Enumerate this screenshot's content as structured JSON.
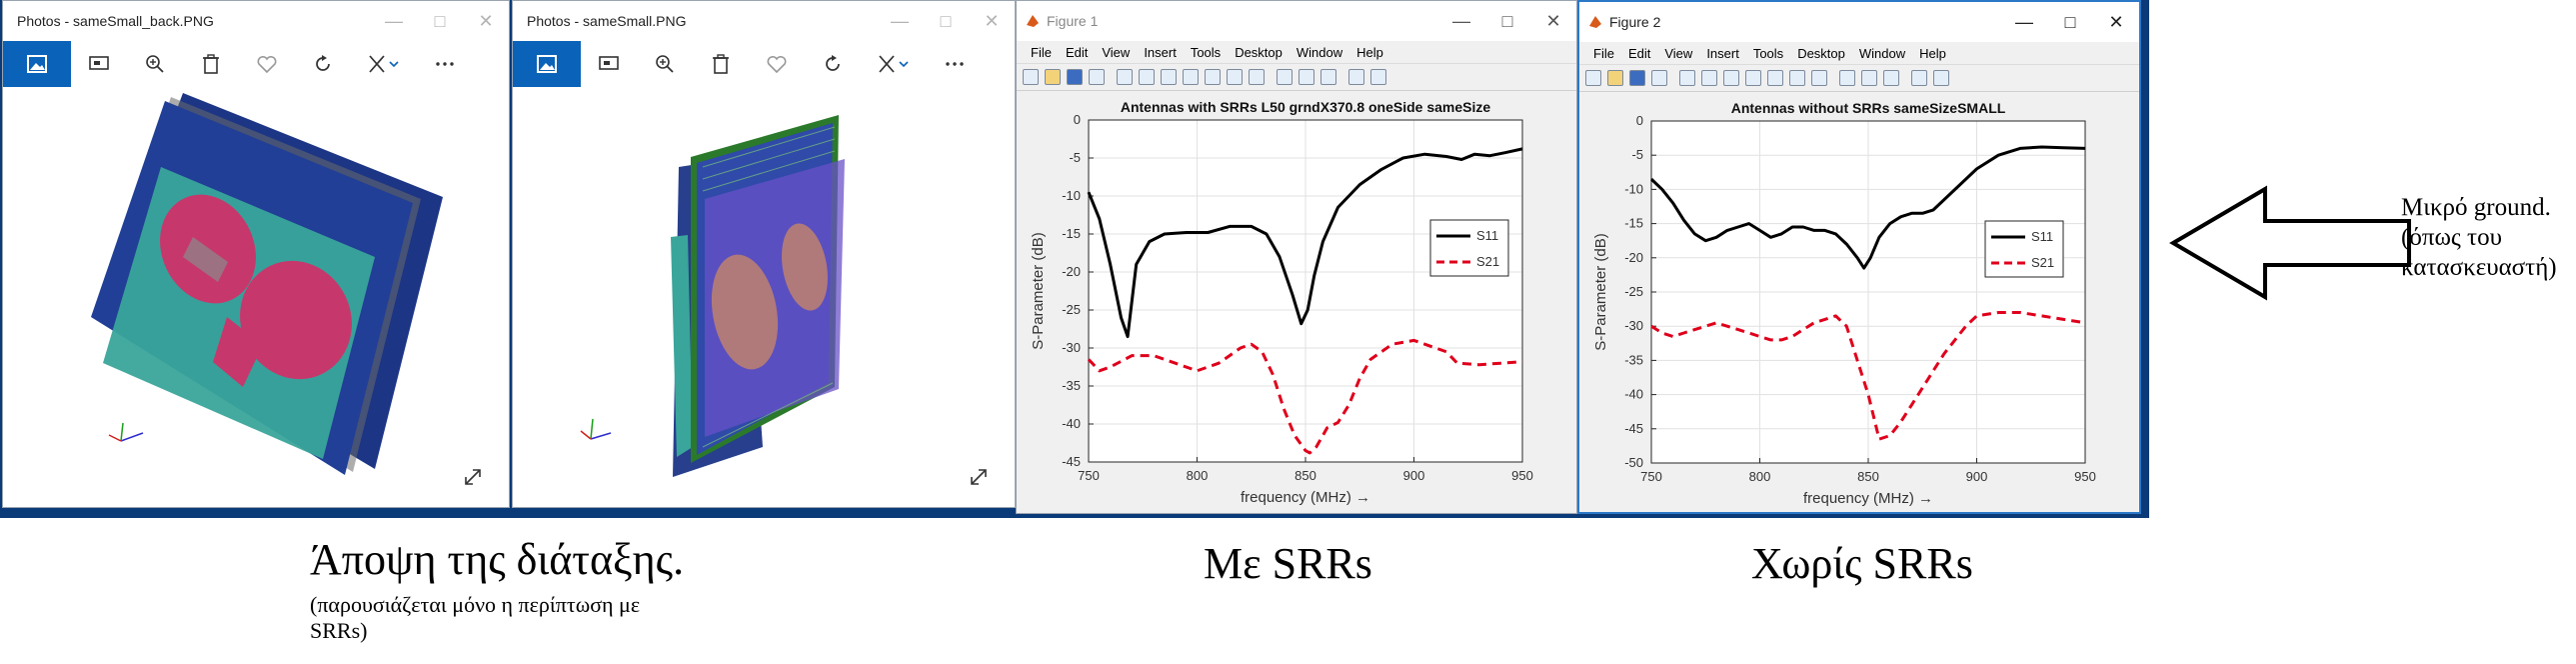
{
  "photos1": {
    "title": "Photos - sameSmall_back.PNG"
  },
  "photos2": {
    "title": "Photos - sameSmall.PNG"
  },
  "photo_toolbar": {
    "icons": [
      "image-icon",
      "slideshow-icon",
      "zoom-icon",
      "delete-icon",
      "favorite-icon",
      "rotate-icon",
      "edit-icon",
      "more-icon"
    ]
  },
  "figure1": {
    "window_title": "Figure 1",
    "menus": [
      "File",
      "Edit",
      "View",
      "Insert",
      "Tools",
      "Desktop",
      "Window",
      "Help"
    ]
  },
  "figure2": {
    "window_title": "Figure 2",
    "menus": [
      "File",
      "Edit",
      "View",
      "Insert",
      "Tools",
      "Desktop",
      "Window",
      "Help"
    ]
  },
  "captions": {
    "view_title": "Άποψη της διάταξης.",
    "view_note_line1": "(παρουσιάζεται μόνο η περίπτωση με",
    "view_note_line2": "SRRs)",
    "with_srr": "Με SRRs",
    "without_srr": "Χωρίς SRRs",
    "ground_line1": "Μικρό ground.",
    "ground_line2": "(όπως του",
    "ground_line3": "κατασκευαστή)"
  },
  "chart_data": [
    {
      "type": "line",
      "title": "Antennas with SRRs L50 grndX370.8 oneSide sameSize",
      "xlabel": "frequency (MHz) →",
      "ylabel": "S-Parameter (dB)",
      "xlim": [
        750,
        950
      ],
      "ylim": [
        -45,
        0
      ],
      "xticks": [
        750,
        800,
        850,
        900,
        950
      ],
      "yticks": [
        0,
        -5,
        -10,
        -15,
        -20,
        -25,
        -30,
        -35,
        -40,
        -45
      ],
      "legend_position": "right-middle",
      "series": [
        {
          "name": "S11",
          "color": "#000000",
          "dash": "solid",
          "x": [
            750,
            755,
            760,
            765,
            768,
            772,
            778,
            785,
            795,
            805,
            815,
            825,
            832,
            838,
            844,
            848,
            851,
            854,
            858,
            865,
            875,
            885,
            895,
            905,
            915,
            922,
            928,
            935,
            942,
            950
          ],
          "y": [
            -9.5,
            -13,
            -19,
            -26,
            -28.5,
            -19,
            -16,
            -15,
            -14.8,
            -14.8,
            -14,
            -14,
            -15,
            -18,
            -23,
            -26.8,
            -25,
            -20.5,
            -16,
            -11.5,
            -8.5,
            -6.5,
            -5,
            -4.5,
            -4.8,
            -5.2,
            -4.5,
            -4.7,
            -4.3,
            -3.8
          ]
        },
        {
          "name": "S21",
          "color": "#e0001b",
          "dash": "dashed",
          "x": [
            750,
            755,
            760,
            770,
            780,
            790,
            800,
            810,
            815,
            820,
            825,
            830,
            835,
            840,
            845,
            850,
            852,
            855,
            860,
            865,
            870,
            875,
            880,
            890,
            900,
            910,
            915,
            920,
            930,
            940,
            950
          ],
          "y": [
            -31.5,
            -33,
            -32.5,
            -31,
            -31,
            -32,
            -33,
            -32,
            -31,
            -30,
            -29.5,
            -30.5,
            -33.5,
            -38,
            -41.5,
            -43.5,
            -43.8,
            -43,
            -40.5,
            -39.8,
            -37.5,
            -34,
            -31.5,
            -29.5,
            -29,
            -30,
            -30.5,
            -32,
            -32.2,
            -32,
            -31.8
          ]
        }
      ]
    },
    {
      "type": "line",
      "title": "Antennas without SRRs sameSizeSMALL",
      "xlabel": "frequency (MHz) →",
      "ylabel": "S-Parameter (dB)",
      "xlim": [
        750,
        950
      ],
      "ylim": [
        -50,
        0
      ],
      "xticks": [
        750,
        800,
        850,
        900,
        950
      ],
      "yticks": [
        0,
        -5,
        -10,
        -15,
        -20,
        -25,
        -30,
        -35,
        -40,
        -45,
        -50
      ],
      "legend_position": "right-middle",
      "series": [
        {
          "name": "S11",
          "color": "#000000",
          "dash": "solid",
          "x": [
            750,
            755,
            760,
            765,
            770,
            775,
            780,
            785,
            790,
            795,
            800,
            805,
            810,
            815,
            820,
            825,
            830,
            835,
            840,
            845,
            848,
            851,
            855,
            860,
            865,
            870,
            875,
            880,
            890,
            900,
            910,
            920,
            930,
            940,
            950
          ],
          "y": [
            -8.5,
            -10,
            -12,
            -14.5,
            -16.5,
            -17.5,
            -17,
            -16,
            -15.5,
            -15,
            -16,
            -17,
            -16.5,
            -15.5,
            -15.5,
            -16,
            -16,
            -16.5,
            -18,
            -20,
            -21.5,
            -20,
            -17,
            -15,
            -14,
            -13.5,
            -13.5,
            -13,
            -10,
            -7,
            -5,
            -4,
            -3.8,
            -3.9,
            -4
          ]
        },
        {
          "name": "S21",
          "color": "#e0001b",
          "dash": "dashed",
          "x": [
            750,
            755,
            760,
            765,
            770,
            775,
            780,
            785,
            790,
            795,
            800,
            805,
            810,
            815,
            820,
            825,
            830,
            835,
            840,
            845,
            850,
            855,
            860,
            865,
            870,
            875,
            880,
            885,
            890,
            895,
            900,
            910,
            920,
            930,
            940,
            950
          ],
          "y": [
            -30,
            -31,
            -31.5,
            -31,
            -30.5,
            -30,
            -29.5,
            -30,
            -30.5,
            -31,
            -31.5,
            -32,
            -32,
            -31.5,
            -30.5,
            -29.5,
            -29,
            -28.5,
            -30,
            -35,
            -40,
            -46.5,
            -46,
            -44,
            -41.5,
            -39,
            -36.5,
            -34,
            -32,
            -30,
            -28.5,
            -28,
            -28,
            -28.5,
            -29,
            -29.5
          ]
        }
      ]
    }
  ]
}
